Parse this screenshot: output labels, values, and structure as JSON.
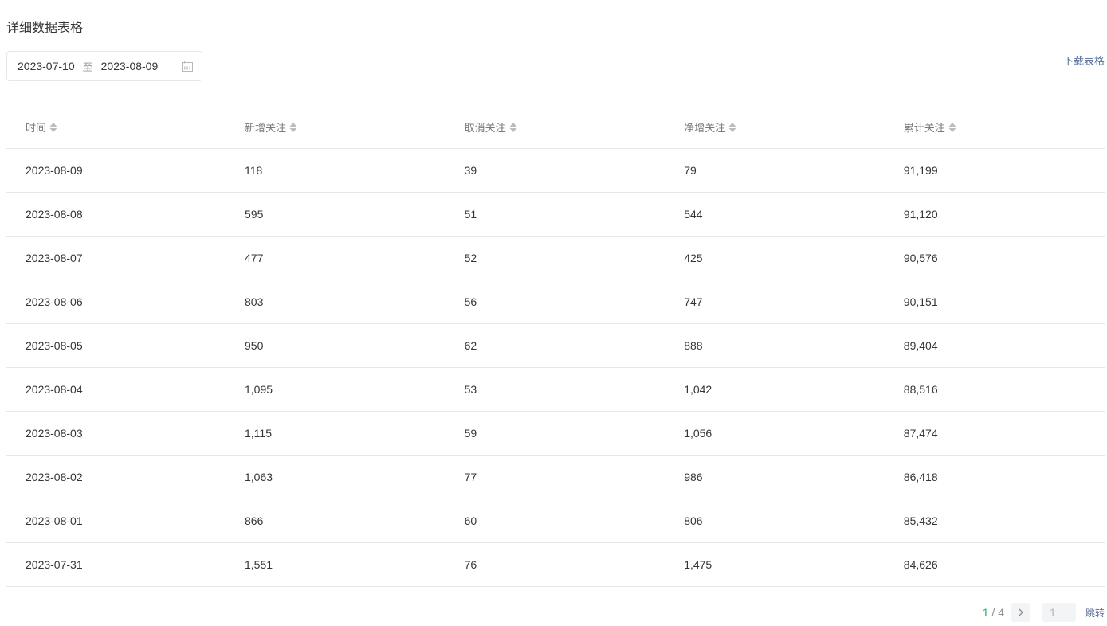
{
  "title": "详细数据表格",
  "date_range": {
    "start": "2023-07-10",
    "separator": "至",
    "end": "2023-08-09"
  },
  "download_label": "下载表格",
  "table": {
    "columns": [
      "时间",
      "新增关注",
      "取消关注",
      "净增关注",
      "累计关注"
    ],
    "rows": [
      [
        "2023-08-09",
        "118",
        "39",
        "79",
        "91,199"
      ],
      [
        "2023-08-08",
        "595",
        "51",
        "544",
        "91,120"
      ],
      [
        "2023-08-07",
        "477",
        "52",
        "425",
        "90,576"
      ],
      [
        "2023-08-06",
        "803",
        "56",
        "747",
        "90,151"
      ],
      [
        "2023-08-05",
        "950",
        "62",
        "888",
        "89,404"
      ],
      [
        "2023-08-04",
        "1,095",
        "53",
        "1,042",
        "88,516"
      ],
      [
        "2023-08-03",
        "1,115",
        "59",
        "1,056",
        "87,474"
      ],
      [
        "2023-08-02",
        "1,063",
        "77",
        "986",
        "86,418"
      ],
      [
        "2023-08-01",
        "866",
        "60",
        "806",
        "85,432"
      ],
      [
        "2023-07-31",
        "1,551",
        "76",
        "1,475",
        "84,626"
      ]
    ]
  },
  "pagination": {
    "current": "1",
    "separator": " / ",
    "total": "4",
    "input_value": "1",
    "jump_label": "跳转"
  },
  "icons": {
    "sort": "sort-icon",
    "calendar": "calendar-icon",
    "next": "chevron-right-icon"
  },
  "colors": {
    "accent_green": "#07c160",
    "link_blue": "#576b95",
    "border": "#e7e7eb"
  }
}
